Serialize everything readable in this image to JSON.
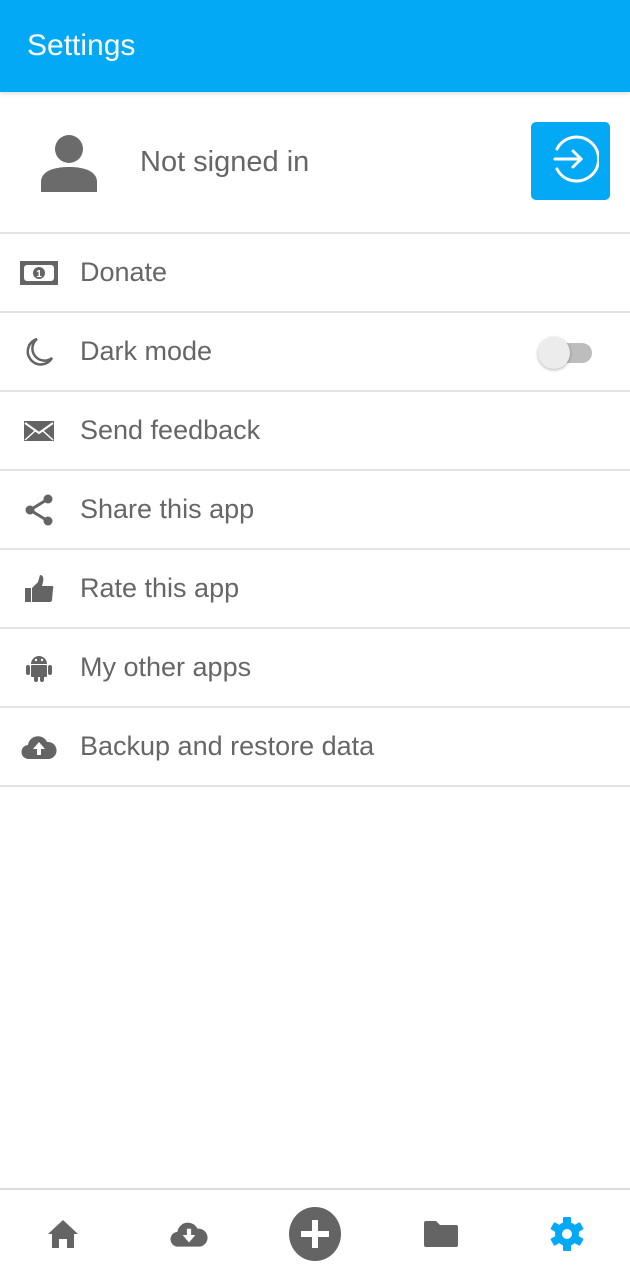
{
  "appbar": {
    "title": "Settings"
  },
  "account": {
    "status": "Not signed in",
    "signin_icon": "login-arrow-icon"
  },
  "menu": {
    "items": [
      {
        "label": "Donate",
        "icon": "money-bill-icon"
      },
      {
        "label": "Dark mode",
        "icon": "moon-icon",
        "toggle": false
      },
      {
        "label": "Send feedback",
        "icon": "envelope-icon"
      },
      {
        "label": "Share this app",
        "icon": "share-icon"
      },
      {
        "label": "Rate this app",
        "icon": "thumbs-up-icon"
      },
      {
        "label": "My other apps",
        "icon": "android-icon"
      },
      {
        "label": "Backup and restore data",
        "icon": "cloud-upload-icon"
      }
    ]
  },
  "bottom_nav": {
    "items": [
      {
        "name": "home",
        "icon": "home-icon",
        "active": false
      },
      {
        "name": "downloads",
        "icon": "cloud-download-icon",
        "active": false
      },
      {
        "name": "add",
        "icon": "plus-circle-icon",
        "active": false
      },
      {
        "name": "files",
        "icon": "folder-icon",
        "active": false
      },
      {
        "name": "settings",
        "icon": "gear-icon",
        "active": true
      }
    ]
  },
  "colors": {
    "primary": "#03A9F4",
    "icon": "#646464",
    "divider": "#e3e3e3"
  }
}
